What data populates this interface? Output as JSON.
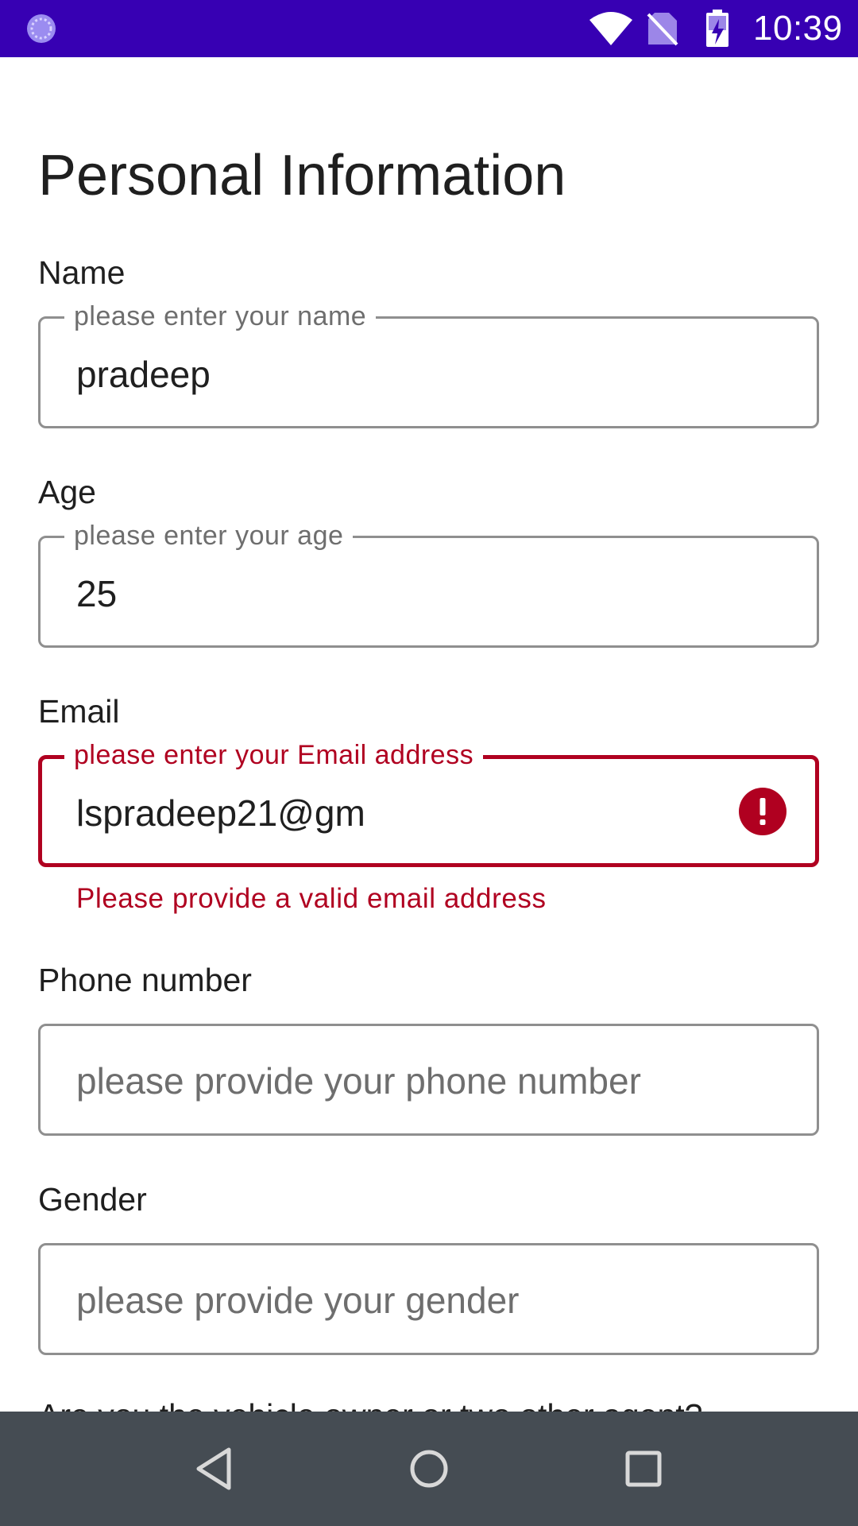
{
  "status_bar": {
    "time": "10:39",
    "icons": [
      "app-notification-icon",
      "wifi-icon",
      "no-sim-icon",
      "battery-charging-icon"
    ],
    "background_color": "#3700b3"
  },
  "page": {
    "title": "Personal Information"
  },
  "form": {
    "name": {
      "label": "Name",
      "floating_label": "please enter your name",
      "value": "pradeep"
    },
    "age": {
      "label": "Age",
      "floating_label": "please enter your age",
      "value": "25"
    },
    "email": {
      "label": "Email",
      "floating_label": "please enter your Email address",
      "value": "lspradeep21@gm",
      "error": "Please provide a valid email address",
      "error_color": "#b00020"
    },
    "phone": {
      "label": "Phone number",
      "placeholder": "please provide your phone number",
      "value": ""
    },
    "gender": {
      "label": "Gender",
      "placeholder": "please provide your gender",
      "value": ""
    },
    "next_question_partial": "Are you the vehicle owner or two other agent?"
  },
  "nav_bar": {
    "buttons": [
      "back-icon",
      "home-icon",
      "recents-icon"
    ]
  }
}
